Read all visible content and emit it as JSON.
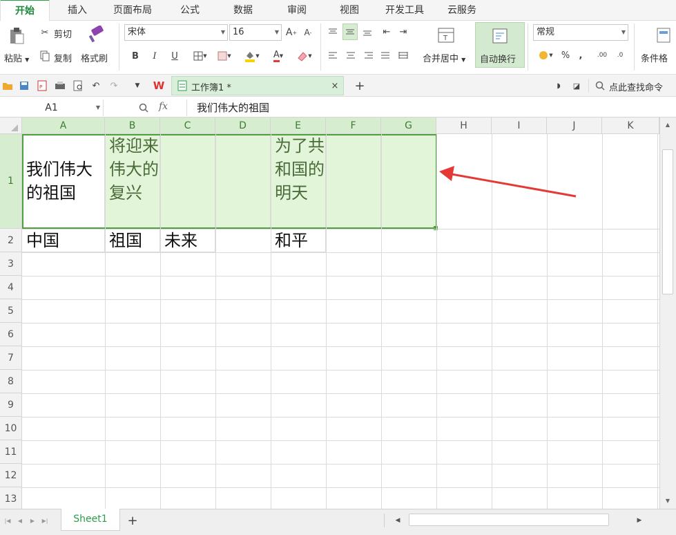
{
  "menu": {
    "tabs": [
      "开始",
      "插入",
      "页面布局",
      "公式",
      "数据",
      "审阅",
      "视图",
      "开发工具",
      "云服务"
    ],
    "active": "开始"
  },
  "ribbon": {
    "paste": "粘贴",
    "cut": "剪切",
    "copy": "复制",
    "format_painter": "格式刷",
    "font_name": "宋体",
    "font_size": "16",
    "merge_center": "合并居中",
    "wrap_text": "自动换行",
    "number_format": "常规",
    "conditional": "条件格"
  },
  "qat": {
    "doc_title": "工作簿1 *",
    "search": "点此查找命令"
  },
  "formula_bar": {
    "name_box": "A1",
    "fx": "fx",
    "content": "我们伟大的祖国"
  },
  "grid": {
    "columns": [
      "A",
      "B",
      "C",
      "D",
      "E",
      "F",
      "G",
      "H",
      "I",
      "J",
      "K"
    ],
    "rows": [
      "1",
      "2",
      "3",
      "4",
      "5",
      "6",
      "7",
      "8",
      "9",
      "10",
      "11",
      "12",
      "13"
    ],
    "cells": {
      "A1": "我们伟大的祖国",
      "B1": "将迎来伟大的复兴",
      "E1": "为了共和国的明天",
      "A2": "中国",
      "B2": "祖国",
      "C2": "未来",
      "E2": "和平"
    }
  },
  "sheets": [
    "Sheet1"
  ],
  "colors": {
    "accent": "#2a9e4a",
    "selection": "#e2f5d9",
    "arrow": "#e53935"
  }
}
